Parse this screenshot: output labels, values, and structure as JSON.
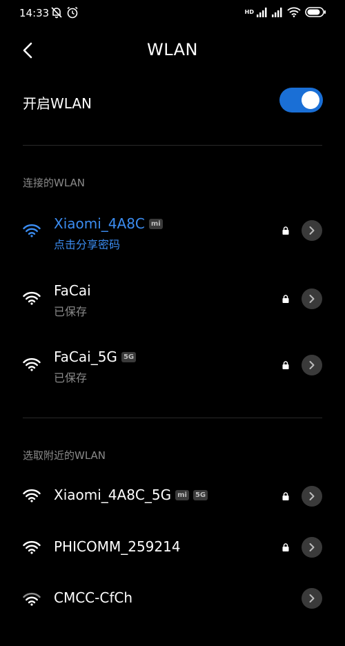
{
  "status_bar": {
    "time": "14:33",
    "network_badge": "HD",
    "icons": [
      "mute-icon",
      "alarm-icon",
      "signal-icon",
      "signal-icon",
      "wifi-icon",
      "battery-icon"
    ]
  },
  "header": {
    "title": "WLAN"
  },
  "wlan_toggle": {
    "label": "开启WLAN",
    "enabled": true
  },
  "connected_section": {
    "label": "连接的WLAN",
    "networks": [
      {
        "name": "Xiaomi_4A8C",
        "badge": "mi",
        "subtitle": "点击分享密码",
        "connected": true
      }
    ]
  },
  "saved_networks": [
    {
      "name": "FaCai",
      "subtitle": "已保存"
    },
    {
      "name": "FaCai_5G",
      "badge": "5G",
      "subtitle": "已保存"
    }
  ],
  "nearby_section": {
    "label": "选取附近的WLAN",
    "networks": [
      {
        "name": "Xiaomi_4A8C_5G",
        "badges": [
          "mi",
          "5G"
        ]
      },
      {
        "name": "PHICOMM_259214"
      },
      {
        "name": "CMCC-CfCh"
      }
    ]
  },
  "colors": {
    "accent": "#1a6fd6",
    "connected_text": "#3b8cf0",
    "background": "#000000",
    "muted_text": "#8a8a8a"
  }
}
